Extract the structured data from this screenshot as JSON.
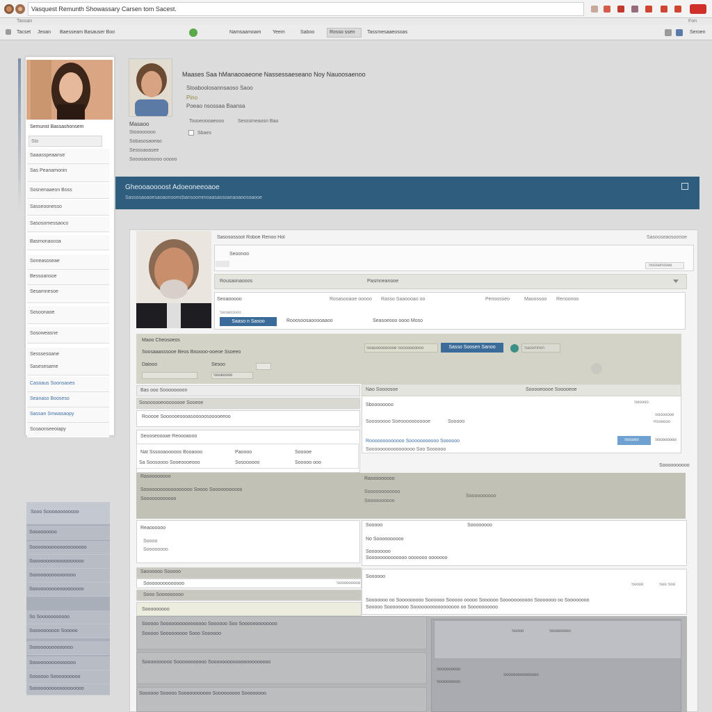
{
  "browser": {
    "title": "Vasquest Remunth Showassary Carsen tom Sacest.",
    "subbar_text": "Tassan",
    "right_text": "Fon"
  },
  "menubar": {
    "left_items": [
      "Tacset",
      "Jeoan",
      "Baesseam Basauser Boo"
    ],
    "tabs": [
      "Namsaamoam",
      "Yeem",
      "Saboo",
      "Rosso ssen",
      "Tassmesaaeosoas"
    ],
    "right_label": "Seroen"
  },
  "sidebar": {
    "name": "Semunst Bassashonsem",
    "items": [
      "Slo",
      "Saaasspeaanse",
      "Sas Peanamonin",
      "Sosnenaaeon Boss",
      "Sasseoonesso",
      "Sasosomessaoco",
      "Basmonaocoa",
      "Soneasoseae",
      "Bessoansoe",
      "Sesamnesoe",
      "Sosoonaoe",
      "Sosoweasne",
      "Sesssesoane",
      "Sasesesame",
      "Casoaus Soonsaoes",
      "Seanaso Booseso",
      "Sassan Smwasaopy",
      "Scoaonseeoiapy"
    ]
  },
  "profile": {
    "heading": "Maases Saa hManaooaeone Nassessaeseano Noy Nauoosaenoo",
    "line1": "Stoaboolosannsaoso Saoo",
    "line2": "Pino",
    "line3": "Poeao nsossaa Baansa",
    "line4_a": "Toooeoooaeooo",
    "line4_b": "Sesssmeaosn Bao",
    "badge": "Sbaes",
    "left_name": "Masaoo",
    "left_1": "Stoooooooo",
    "left_2": "Sobasosaoeao",
    "left_3": "Sessoaoasee",
    "left_4": "Sooooaoosooo ooooo"
  },
  "banner": {
    "title": "Gheooaoooost Adoeoneeoaoe",
    "subtitle": "Sassosaoaoesaoaonsomcbansoommoaasassoanaoaoosoaooe"
  },
  "panel": {
    "top_label": "Sasosossoot  Roboe  Renoo  Hol",
    "top_right": "Sasooseaosoonoe",
    "search_label": "Seoonoo",
    "search_right": "Soosenosee",
    "row1_left": "Rousaonaooos",
    "row1_mid": "Pasmneanooe",
    "f_label": "Seoaooooo",
    "f_a": "Rosasooaoe  ooooo",
    "f_b": "Rasso  Saaoooao oo",
    "f_c": "Penoosseo",
    "f_d": "Maoossoo",
    "f_e": "Renoonoo",
    "blue_btn": "Saaso n Sasoo",
    "f_g": "Rooosoosaooooaaoo",
    "f_h": "Seasoeooo oooo  Moso",
    "sec1_title": "Maoo Cheosoeos",
    "sec1_line": "Soosaaasssooe  Beos  Bisoooo-ooeoe  Ssoeeo",
    "sec1_a": "Dalooo",
    "sec1_b": "Sesoo",
    "sec1_c": "Sooeoooo",
    "sec1_btn": "Sasso  Soosen  Sanoo",
    "sec1_right": "Saoomnen",
    "sec1_form_label": "Soasoooooosoe  Soosooeoooo",
    "row_a": "Bas ooo Soooooooon",
    "row_b": "Sosoosooeoooooooe  Sooeoe",
    "row_c": "Rooooe Soooooeoooasooooosooooeeoo",
    "sec2_title": "Seooseoooae Reoooaooo",
    "tbl_a": "Nat Sssooaooooos Booaooo",
    "tbl_b": "Paoooo",
    "tbl_c": "Sooooe",
    "tbl_d": "Sa  Soosoooo  Sooeoooeooo",
    "tbl_e": "Sosoooooo",
    "tbl_f": "Sooooo ooo",
    "right1_title": "Nao Soooosoe",
    "right1_b": "Sooooeoooe  Sooooeoe",
    "right1_c": "Sboooooooo",
    "right1_d": "Sooooo",
    "right1_e": "Sooooooe",
    "right1_f": "Soooooooo Soeooooooooooe",
    "right1_g": "Sooooo",
    "right1_h": "Rooooooooooooo  Sooooooooooo  Soooooo",
    "right1_i": "Sooooooooooooooooo  Soo Soooooo",
    "right1_btn": "Sooooo",
    "right1_btn_right": "Soooooooo",
    "right1_side": "Rsooooo",
    "sec3_title": "Rasoooooooo",
    "sec3_a": "Soooooooooooooooooo  Soooo  Sooooooooooo",
    "sec3_b": "Soooooooooo",
    "sec3_c": "Soooooooooooo",
    "sec4_title": "Reaoooooo",
    "sec4_a": "Soooo",
    "sec4_b": "Soooooooo",
    "right2_title": "Sooooo",
    "right2_a": "No Soooooooooo",
    "right2_b": "Soooooooo",
    "right2_c": "Soooooooooooooo ooooooo  ooooooo",
    "sec5_title": "Saoooooo Sooooo",
    "sec5_a": "Soooooooooooooo",
    "sec5_b": "Sooooooooo",
    "sec6_title": "Sooo Sooooooooo",
    "sec6_a": "Sooooooooo",
    "right3_title": "Soooooo",
    "right3_a": "Soooo",
    "right3_b": "Soo Soo",
    "right3_line": "Sooooooo oo Sooooooooo  Soooooo Sooooo  ooooo  Soooooo Sooooooooooo  Sooooooo oo Soooooooo",
    "right3_line2": "Sooooo  Soooooooo  Sooooooooooooooooo oo Soooooooooo",
    "bottom_a": "Sooooo Soooooooooooooooo Soooooo  Soo Sooooooooooooo",
    "bottom_a2": "Sooooo Sooooooooo  Sooo  Soooooo",
    "bottom_b": "Soooooooooo  Sooooooooooo  Soooooooooooooooooooooo",
    "bottom_c": "Soooooo  Sooooo  Sooooooooooo Sooooooooo  Soooooooo"
  },
  "gray_list": {
    "header": "Sooo  Soooooooooooo",
    "items": [
      "Sooooooooo",
      "Soooooooooooooooooooo",
      "Sooooooooooooooooooo",
      "Soooooooooooooooo",
      "Sooooooooooooooooooo",
      "So Sooooooooooo",
      "Soooooooooo  Sooooo",
      "Sooooooooooooooo",
      "Soooooooooooooooo",
      "Soooooo  Soooooooooo",
      "Sooooooooooooooooooo"
    ]
  }
}
